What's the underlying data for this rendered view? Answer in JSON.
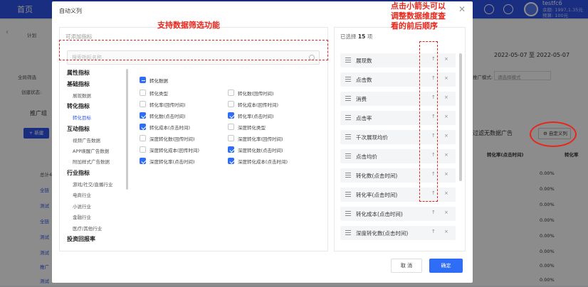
{
  "topbar": {
    "home": "首页",
    "user": "testfc6",
    "balance1": "余额: 1997,1.35元",
    "balance2": "预算: 100元"
  },
  "bg": {
    "plan_label": "计划",
    "date_range": "2022-05-07 至 2022-05-07",
    "filter_label": "全局筛选",
    "state_label": "创建状态:",
    "group_tab": "推广组",
    "new_btn": "+ 新建",
    "mode_label": "推广模式:",
    "mode_value": "请选择模式",
    "hide_label": "过滤无数据广告",
    "custom_btn": "自定义列",
    "col_header": "转化率(点击时间)",
    "col_header2": "转化率",
    "total_label": "总计4",
    "rows": [
      "全链",
      "测试",
      "全链",
      "测试",
      "测试",
      "推广",
      "测试"
    ],
    "pcts": [
      "0.00%",
      "0.00%",
      "0.00%",
      "0.00%",
      "0.00%",
      "0.00%",
      "0.00%",
      "0.00%"
    ]
  },
  "modal": {
    "title": "自动义列",
    "left_head": "可添加指标",
    "search_placeholder": "搜索指标名称",
    "categories": [
      {
        "head": "属性指标",
        "items": []
      },
      {
        "head": "基础指标",
        "items": [
          "展现数据"
        ]
      },
      {
        "head": "转化指标",
        "items": [
          "转化目标"
        ]
      },
      {
        "head": "互动指标",
        "items": [
          "视频广告数据",
          "APP唤醒广告数据",
          "附加样式广告数据"
        ]
      },
      {
        "head": "行业指标",
        "items": [
          "游戏/社交/直播行业",
          "电商行业",
          "小说行业",
          "金融行业",
          "医疗/其他行业"
        ]
      },
      {
        "head": "投资回报率",
        "items": []
      }
    ],
    "group_title": "转化数据",
    "options_left": [
      "转化类型",
      "转化率(回传时间)",
      "转化数(点击时间)",
      "转化成本(点击时间)",
      "深度转化数(回传时间)",
      "深度转化成本(回传时间)",
      "深度转化率(点击时间)"
    ],
    "options_right": [
      "转化数(回传时间)",
      "转化成本(回传时间)",
      "转化率(点击时间)",
      "深度转化类型",
      "深度转化率(回传时间)",
      "深度转化数(点击时间)",
      "深度转化成本(点击时间)"
    ],
    "checked_left": [
      false,
      false,
      true,
      true,
      false,
      false,
      true
    ],
    "checked_right": [
      false,
      false,
      true,
      false,
      false,
      true,
      true
    ],
    "right_head_prefix": "已选择",
    "right_head_count": "15",
    "right_head_suffix": "项",
    "selected": [
      "展现数",
      "点击数",
      "消费",
      "点击率",
      "千次展现均价",
      "点击均价",
      "转化数(点击时间)",
      "转化率(点击时间)",
      "转化成本(点击时间)",
      "深度转化数(点击时间)"
    ],
    "cancel": "取 消",
    "ok": "确定"
  },
  "annotations": {
    "filter_note": "支持数据筛选功能",
    "arrow_note_1": "点击小箭头可以",
    "arrow_note_2": "调整数据维度查",
    "arrow_note_3": "看的前后顺序"
  },
  "colors": {
    "accent": "#2f6df6",
    "annotation": "#e8261a",
    "topbar": "#2f54eb"
  }
}
